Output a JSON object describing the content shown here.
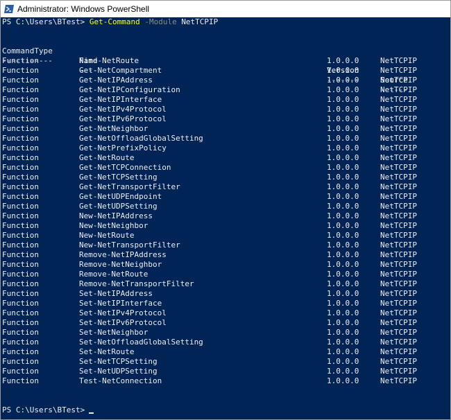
{
  "window": {
    "title": "Administrator: Windows PowerShell",
    "icon": "powershell-icon",
    "colors": {
      "background": "#012456",
      "text": "#eeedf0",
      "command": "#ffff00",
      "parameter": "#8a8a8a"
    }
  },
  "console": {
    "prompt": "PS C:\\Users\\BTest>",
    "command": "Get-Command",
    "parameter": "-Module",
    "argument": "NetTCPIP",
    "headers": [
      "CommandType",
      "Name",
      "Version",
      "Source"
    ],
    "underlines": [
      "-----------",
      "----",
      "-------",
      "------"
    ],
    "rows": [
      [
        "Function",
        "Find-NetRoute",
        "1.0.0.0",
        "NetTCPIP"
      ],
      [
        "Function",
        "Get-NetCompartment",
        "1.0.0.0",
        "NetTCPIP"
      ],
      [
        "Function",
        "Get-NetIPAddress",
        "1.0.0.0",
        "NetTCPIP"
      ],
      [
        "Function",
        "Get-NetIPConfiguration",
        "1.0.0.0",
        "NetTCPIP"
      ],
      [
        "Function",
        "Get-NetIPInterface",
        "1.0.0.0",
        "NetTCPIP"
      ],
      [
        "Function",
        "Get-NetIPv4Protocol",
        "1.0.0.0",
        "NetTCPIP"
      ],
      [
        "Function",
        "Get-NetIPv6Protocol",
        "1.0.0.0",
        "NetTCPIP"
      ],
      [
        "Function",
        "Get-NetNeighbor",
        "1.0.0.0",
        "NetTCPIP"
      ],
      [
        "Function",
        "Get-NetOffloadGlobalSetting",
        "1.0.0.0",
        "NetTCPIP"
      ],
      [
        "Function",
        "Get-NetPrefixPolicy",
        "1.0.0.0",
        "NetTCPIP"
      ],
      [
        "Function",
        "Get-NetRoute",
        "1.0.0.0",
        "NetTCPIP"
      ],
      [
        "Function",
        "Get-NetTCPConnection",
        "1.0.0.0",
        "NetTCPIP"
      ],
      [
        "Function",
        "Get-NetTCPSetting",
        "1.0.0.0",
        "NetTCPIP"
      ],
      [
        "Function",
        "Get-NetTransportFilter",
        "1.0.0.0",
        "NetTCPIP"
      ],
      [
        "Function",
        "Get-NetUDPEndpoint",
        "1.0.0.0",
        "NetTCPIP"
      ],
      [
        "Function",
        "Get-NetUDPSetting",
        "1.0.0.0",
        "NetTCPIP"
      ],
      [
        "Function",
        "New-NetIPAddress",
        "1.0.0.0",
        "NetTCPIP"
      ],
      [
        "Function",
        "New-NetNeighbor",
        "1.0.0.0",
        "NetTCPIP"
      ],
      [
        "Function",
        "New-NetRoute",
        "1.0.0.0",
        "NetTCPIP"
      ],
      [
        "Function",
        "New-NetTransportFilter",
        "1.0.0.0",
        "NetTCPIP"
      ],
      [
        "Function",
        "Remove-NetIPAddress",
        "1.0.0.0",
        "NetTCPIP"
      ],
      [
        "Function",
        "Remove-NetNeighbor",
        "1.0.0.0",
        "NetTCPIP"
      ],
      [
        "Function",
        "Remove-NetRoute",
        "1.0.0.0",
        "NetTCPIP"
      ],
      [
        "Function",
        "Remove-NetTransportFilter",
        "1.0.0.0",
        "NetTCPIP"
      ],
      [
        "Function",
        "Set-NetIPAddress",
        "1.0.0.0",
        "NetTCPIP"
      ],
      [
        "Function",
        "Set-NetIPInterface",
        "1.0.0.0",
        "NetTCPIP"
      ],
      [
        "Function",
        "Set-NetIPv4Protocol",
        "1.0.0.0",
        "NetTCPIP"
      ],
      [
        "Function",
        "Set-NetIPv6Protocol",
        "1.0.0.0",
        "NetTCPIP"
      ],
      [
        "Function",
        "Set-NetNeighbor",
        "1.0.0.0",
        "NetTCPIP"
      ],
      [
        "Function",
        "Set-NetOffloadGlobalSetting",
        "1.0.0.0",
        "NetTCPIP"
      ],
      [
        "Function",
        "Set-NetRoute",
        "1.0.0.0",
        "NetTCPIP"
      ],
      [
        "Function",
        "Set-NetTCPSetting",
        "1.0.0.0",
        "NetTCPIP"
      ],
      [
        "Function",
        "Set-NetUDPSetting",
        "1.0.0.0",
        "NetTCPIP"
      ],
      [
        "Function",
        "Test-NetConnection",
        "1.0.0.0",
        "NetTCPIP"
      ]
    ]
  }
}
